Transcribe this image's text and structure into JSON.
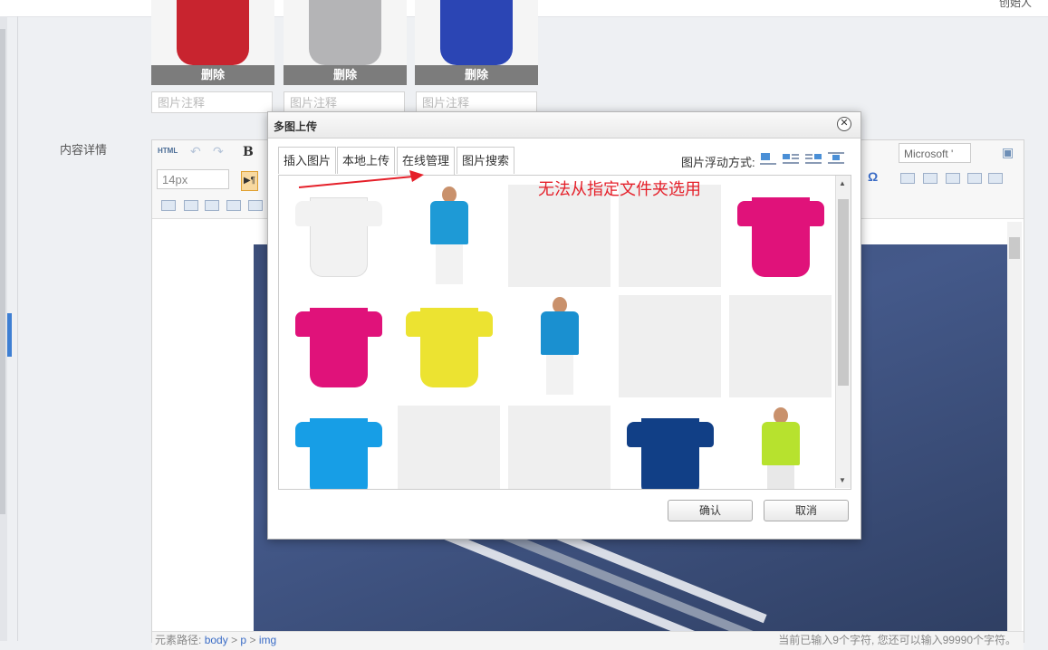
{
  "header": {
    "creator_label": "创始人"
  },
  "thumbnails": [
    {
      "delete_label": "删除",
      "caption_placeholder": "图片注释",
      "color": "#c8242f"
    },
    {
      "delete_label": "删除",
      "caption_placeholder": "图片注释",
      "color": "#b4b4b6"
    },
    {
      "delete_label": "删除",
      "caption_placeholder": "图片注释",
      "color": "#2b45b4"
    }
  ],
  "form": {
    "content_label": "内容详情"
  },
  "editor": {
    "html_label": "HTML",
    "bold_label": "B",
    "font_size": "14px",
    "font_family": "Microsoft '",
    "omega": "Ω",
    "status": {
      "path_label": "元素路径:",
      "path_items": [
        "body",
        "p",
        "img"
      ],
      "separator": ">",
      "char_count": "当前已输入9个字符, 您还可以输入99990个字符。"
    }
  },
  "dialog": {
    "title": "多图上传",
    "close_glyph": "✕",
    "tabs": [
      {
        "label": "插入图片",
        "active": false
      },
      {
        "label": "本地上传",
        "active": false
      },
      {
        "label": "在线管理",
        "active": true
      },
      {
        "label": "图片搜索",
        "active": false
      }
    ],
    "float_label": "图片浮动方式:",
    "float_options": [
      "none-icon",
      "left-icon",
      "right-icon",
      "center-icon"
    ],
    "images": [
      {
        "kind": "shirt",
        "color": "#f2f2f2"
      },
      {
        "kind": "person",
        "color": "#1e9ad6"
      },
      {
        "kind": "empty",
        "color": "#efefef"
      },
      {
        "kind": "empty",
        "color": "#efefef"
      },
      {
        "kind": "shirt",
        "color": "#e0127a"
      },
      {
        "kind": "shirt",
        "color": "#e0127a"
      },
      {
        "kind": "shirt",
        "color": "#ece331"
      },
      {
        "kind": "person",
        "color": "#1a90d0"
      },
      {
        "kind": "empty",
        "color": "#efefef"
      },
      {
        "kind": "empty",
        "color": "#efefef"
      },
      {
        "kind": "shirt",
        "color": "#179ee6"
      },
      {
        "kind": "empty",
        "color": "#efefef"
      },
      {
        "kind": "empty",
        "color": "#efefef"
      },
      {
        "kind": "shirt",
        "color": "#113f86"
      },
      {
        "kind": "person",
        "color": "#b7e22e"
      }
    ],
    "confirm_label": "确认",
    "cancel_label": "取消"
  },
  "annotation": {
    "text": "无法从指定文件夹选用",
    "color": "#e5202a"
  }
}
